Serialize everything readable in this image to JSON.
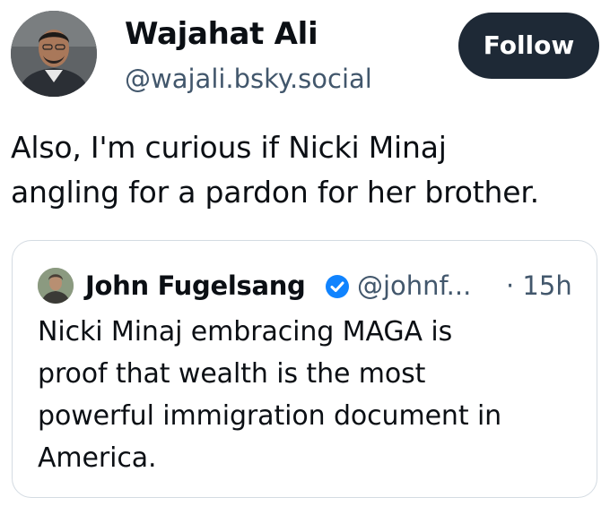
{
  "author": {
    "display_name": "Wajahat Ali",
    "handle": "@wajali.bsky.social",
    "avatar": "profile-photo"
  },
  "follow_button": {
    "label": "Follow"
  },
  "post": {
    "text_line1": "Also, I'm curious if Nicki Minaj",
    "text_line2": "angling for a pardon for her brother."
  },
  "quoted_post": {
    "author_name": "John Fugelsang",
    "verified_icon": "verified-check-icon",
    "handle": "@johnf...",
    "time": "· 15h",
    "text_line1": "Nicki Minaj embracing MAGA is",
    "text_line2": "proof that wealth is the most",
    "text_line3": "powerful immigration document in",
    "text_line4": "America."
  },
  "colors": {
    "follow_bg": "#1e2936",
    "secondary_text": "#42576c",
    "verified_blue": "#1083fe",
    "card_border": "#d4dbe2"
  }
}
